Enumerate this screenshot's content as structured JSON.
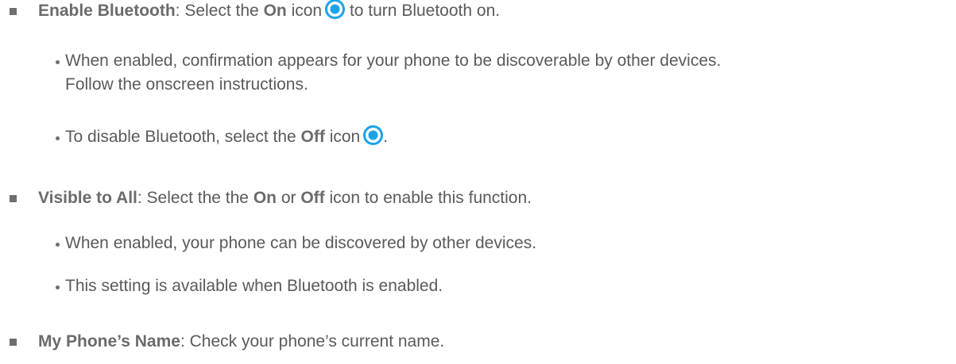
{
  "colors": {
    "text": "#5a5a5a",
    "bold": "#6b6b6b",
    "icon_blue": "#1aa3e8",
    "bullet": "#6e6e6e"
  },
  "items": [
    {
      "label": "Enable Bluetooth",
      "sep": ": Select the ",
      "bold2": "On",
      "after_bold": " icon",
      "icon": "radio-on-icon",
      "tail": " to turn Bluetooth on."
    },
    {
      "line1": "When enabled, confirmation appears for your phone to be discoverable by other devices.",
      "line2": "Follow the onscreen instructions."
    },
    {
      "before": "To disable Bluetooth, select the ",
      "bold": "Off",
      "after": " icon",
      "icon": "radio-on-icon",
      "tail": "."
    },
    {
      "label": "Visible to All",
      "sep": ": Select the the ",
      "bold_on": "On",
      "or": " or ",
      "bold_off": "Off",
      "tail": " icon to enable this function."
    },
    {
      "text": "When enabled, your phone can be discovered by other devices."
    },
    {
      "text": "This setting is available when Bluetooth is enabled."
    },
    {
      "label": "My Phone’s Name",
      "tail": ": Check your phone’s current name."
    }
  ]
}
